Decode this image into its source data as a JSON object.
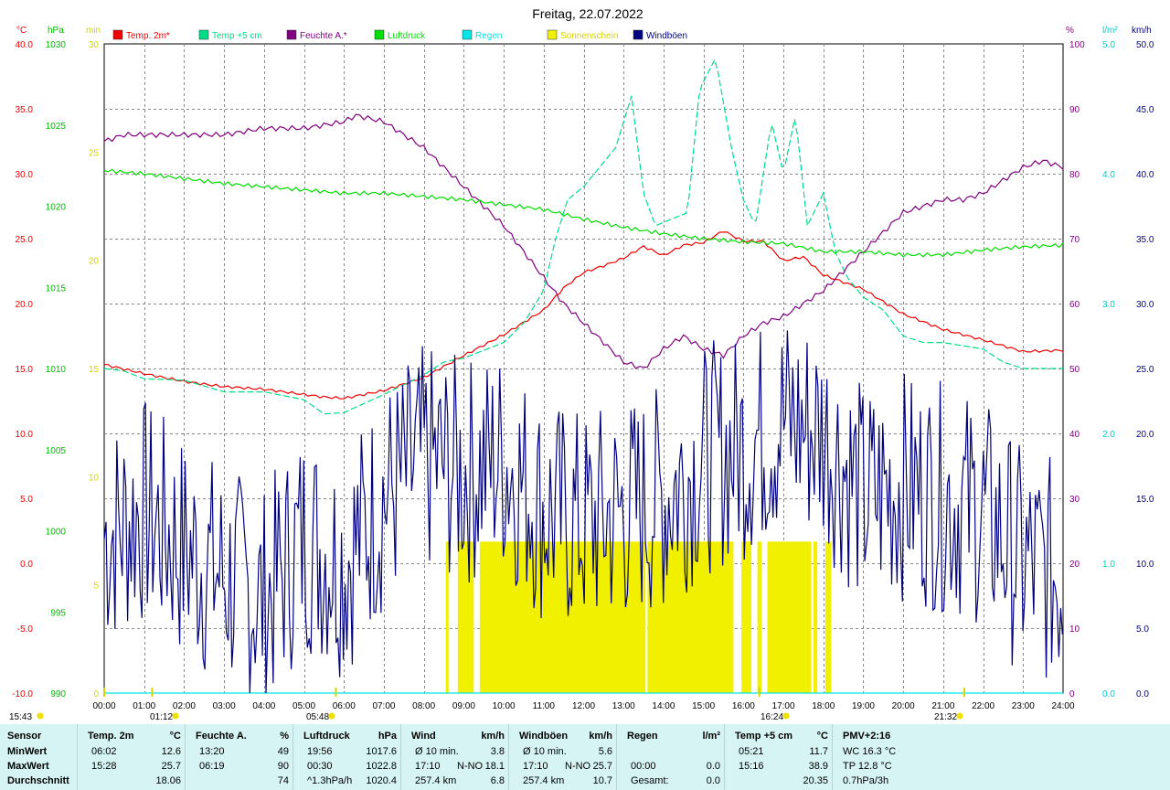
{
  "title": "Freitag, 22.07.2022",
  "axes": {
    "left_units": [
      "°C",
      "hPa",
      "min"
    ],
    "right_units": [
      "%",
      "l/m²",
      "km/h"
    ],
    "temp_ticks": [
      "40.0",
      "35.0",
      "30.0",
      "25.0",
      "20.0",
      "15.0",
      "10.0",
      "5.0",
      "0.0",
      "-5.0",
      "-10.0"
    ],
    "pressure_ticks": [
      "1030",
      "1025",
      "1020",
      "1015",
      "1010",
      "1005",
      "1000",
      "995",
      "990"
    ],
    "sun_ticks": [
      "30",
      "25",
      "20",
      "15",
      "10",
      "5",
      "0"
    ],
    "humidity_ticks": [
      "100",
      "90",
      "80",
      "70",
      "60",
      "50",
      "40",
      "30",
      "20",
      "10",
      "0"
    ],
    "rain_ticks": [
      "5.0",
      "4.0",
      "3.0",
      "2.0",
      "1.0",
      "0.0"
    ],
    "wind_ticks": [
      "50.0",
      "45.0",
      "40.0",
      "35.0",
      "30.0",
      "25.0",
      "20.0",
      "15.0",
      "10.0",
      "5.0",
      "0.0"
    ],
    "time_ticks": [
      "00:00",
      "01:00",
      "02:00",
      "03:00",
      "04:00",
      "05:00",
      "06:00",
      "07:00",
      "08:00",
      "09:00",
      "10:00",
      "11:00",
      "12:00",
      "13:00",
      "14:00",
      "15:00",
      "16:00",
      "17:00",
      "18:00",
      "19:00",
      "20:00",
      "21:00",
      "22:00",
      "23:00",
      "24:00"
    ]
  },
  "markers": {
    "moonset_prev": "15:43",
    "moonset": "01:12",
    "sunrise": "05:48",
    "moonrise": "16:24",
    "sunset": "21:32"
  },
  "legend": [
    {
      "label": "Temp. 2m*",
      "color": "#ee0000"
    },
    {
      "label": "Temp +5 cm",
      "color": "#00dd88"
    },
    {
      "label": "Feuchte A.*",
      "color": "#800080"
    },
    {
      "label": "Luftdruck",
      "color": "#00dd00"
    },
    {
      "label": "Regen",
      "color": "#00e5e5"
    },
    {
      "label": "Sonnenschein",
      "color": "#f0f000"
    },
    {
      "label": "Windböen",
      "color": "#000080"
    }
  ],
  "chart_data": {
    "type": "line",
    "title": "Freitag, 22.07.2022",
    "x_unit": "hour",
    "xlim": [
      0,
      24
    ],
    "series": [
      {
        "name": "Temp. 2m*",
        "unit": "°C",
        "ylim": [
          -10,
          40
        ],
        "color": "#ee0000",
        "x": [
          0,
          1,
          2,
          3,
          4,
          5,
          5.5,
          6,
          6.5,
          7,
          8,
          9,
          10,
          11,
          11.5,
          12,
          12.5,
          13,
          13.5,
          14,
          14.5,
          15,
          15.5,
          16,
          16.5,
          17,
          17.5,
          18,
          19,
          20,
          21,
          22,
          23,
          24
        ],
        "y": [
          15.3,
          14.6,
          14.0,
          13.6,
          13.4,
          13.0,
          12.8,
          12.7,
          13.0,
          13.3,
          14.3,
          16.0,
          17.6,
          19.5,
          21.2,
          22.4,
          22.9,
          23.5,
          24.4,
          23.7,
          24.5,
          24.7,
          25.6,
          24.8,
          24.8,
          23.3,
          23.6,
          22.2,
          21.1,
          19.2,
          18.0,
          17.2,
          16.3,
          16.4
        ]
      },
      {
        "name": "Temp +5 cm",
        "unit": "°C",
        "ylim": [
          -10,
          40
        ],
        "color": "#00dd88",
        "x": [
          0,
          0.5,
          1,
          2,
          3,
          4,
          5,
          5.5,
          6,
          7,
          8,
          8.5,
          9,
          10,
          10.5,
          11,
          11.3,
          11.6,
          12,
          12.4,
          12.8,
          13.2,
          13.5,
          13.8,
          14.2,
          14.6,
          14.9,
          15.3,
          15.7,
          16,
          16.3,
          16.7,
          17,
          17.3,
          17.6,
          18,
          18.3,
          18.6,
          19,
          19.5,
          20,
          20.5,
          21,
          22,
          22.5,
          23,
          24
        ],
        "y": [
          15.0,
          14.8,
          14.2,
          14.1,
          13.2,
          13.2,
          12.6,
          11.5,
          11.6,
          13.0,
          14.5,
          15.5,
          15.8,
          17.0,
          18.5,
          21.0,
          25.0,
          28.0,
          29.0,
          30.5,
          32.0,
          36.0,
          28.5,
          26.0,
          26.5,
          27.0,
          36.5,
          38.9,
          32.0,
          28.0,
          26.0,
          34.0,
          30.0,
          34.5,
          26.0,
          28.5,
          24.0,
          22.0,
          20.5,
          19.5,
          17.5,
          17.0,
          17.0,
          16.5,
          15.5,
          15.0,
          15.0
        ]
      },
      {
        "name": "Feuchte A.*",
        "unit": "%",
        "ylim": [
          0,
          100
        ],
        "color": "#800080",
        "x": [
          0,
          0.5,
          1,
          2,
          3,
          4,
          5,
          6,
          6.3,
          7,
          8,
          9,
          10,
          10.5,
          11,
          11.5,
          12,
          12.5,
          13,
          13.5,
          14,
          14.5,
          15,
          15.5,
          16,
          16.5,
          17,
          17.5,
          18,
          18.5,
          19,
          19.5,
          20,
          20.5,
          21,
          21.5,
          22,
          22.5,
          23,
          23.5,
          24
        ],
        "y": [
          85,
          86,
          86,
          86,
          86,
          87,
          87,
          88,
          89,
          88,
          84,
          78,
          72,
          68,
          64,
          60,
          57,
          54,
          51,
          50,
          53,
          55,
          53,
          52,
          55,
          57,
          58,
          60,
          62,
          65,
          68,
          71,
          74,
          75,
          76,
          76,
          77,
          79,
          81,
          82,
          81
        ]
      },
      {
        "name": "Luftdruck",
        "unit": "hPa",
        "ylim": [
          990,
          1030
        ],
        "color": "#00dd00",
        "x": [
          0,
          1,
          2,
          3,
          4,
          5,
          6,
          7,
          8,
          9,
          10,
          11,
          12,
          13,
          14,
          15,
          16,
          17,
          18,
          19,
          20,
          21,
          22,
          23,
          24
        ],
        "y": [
          1022.2,
          1022.0,
          1021.7,
          1021.4,
          1021.2,
          1021.0,
          1020.8,
          1020.8,
          1020.6,
          1020.4,
          1020.1,
          1019.8,
          1019.2,
          1018.7,
          1018.3,
          1018.0,
          1017.8,
          1017.7,
          1017.2,
          1017.2,
          1017.0,
          1017.0,
          1017.3,
          1017.5,
          1017.6
        ]
      },
      {
        "name": "Regen",
        "unit": "l/m²",
        "ylim": [
          0,
          5
        ],
        "color": "#00e5e5",
        "x": [
          0,
          24
        ],
        "y": [
          0,
          0
        ]
      },
      {
        "name": "Windböen",
        "unit": "km/h",
        "ylim": [
          0,
          50
        ],
        "color": "#000080",
        "x": [
          0,
          1,
          2,
          3,
          4,
          5,
          6,
          7,
          8,
          9,
          10,
          11,
          12,
          13,
          14,
          15,
          16,
          17,
          18,
          19,
          20,
          21,
          22,
          23,
          24
        ],
        "y": [
          12,
          14,
          11,
          9,
          7,
          12,
          10,
          15,
          18,
          17,
          18,
          14,
          13,
          14,
          15,
          18,
          19,
          21,
          20,
          15,
          16,
          15,
          14,
          10,
          9
        ]
      }
    ],
    "sunshine_intervals": [
      [
        8.55,
        8.62
      ],
      [
        8.85,
        9.25
      ],
      [
        9.4,
        13.55
      ],
      [
        13.6,
        15.75
      ],
      [
        15.95,
        16.2
      ],
      [
        16.35,
        16.45
      ],
      [
        16.6,
        17.7
      ],
      [
        17.75,
        17.85
      ],
      [
        18.05,
        18.2
      ]
    ]
  },
  "stats": {
    "headers": [
      {
        "name": "Sensor",
        "unit": ""
      },
      {
        "name": "Temp. 2m",
        "unit": "°C"
      },
      {
        "name": "Feuchte A.",
        "unit": "%"
      },
      {
        "name": "Luftdruck",
        "unit": "hPa"
      },
      {
        "name": "Wind",
        "unit": "km/h"
      },
      {
        "name": "Windböen",
        "unit": "km/h"
      },
      {
        "name": "Regen",
        "unit": "l/m²"
      },
      {
        "name": "Temp +5 cm",
        "unit": "°C"
      },
      {
        "name": "PMV+2:16",
        "unit": ""
      }
    ],
    "rows": [
      "MinWert",
      "MaxWert",
      "Durchschnitt"
    ],
    "temp": [
      [
        "06:02",
        "12.6"
      ],
      [
        "15:28",
        "25.7"
      ],
      [
        "",
        "18.06"
      ]
    ],
    "humidity": [
      [
        "13:20",
        "49"
      ],
      [
        "06:19",
        "90"
      ],
      [
        "",
        "74"
      ]
    ],
    "pressure": [
      [
        "19:56",
        "1017.6"
      ],
      [
        "00:30",
        "1022.8"
      ],
      [
        "^1.3hPa/h",
        "1020.4"
      ]
    ],
    "wind": [
      [
        "Ø 10 min.",
        "",
        "3.8"
      ],
      [
        "17:10",
        "N-NO",
        "18.1"
      ],
      [
        "257.4 km",
        "",
        "6.8"
      ]
    ],
    "gusts": [
      [
        "Ø 10 min.",
        "",
        "5.6"
      ],
      [
        "17:10",
        "N-NO",
        "25.7"
      ],
      [
        "257.4 km",
        "",
        "10.7"
      ]
    ],
    "rain": [
      [
        "",
        ""
      ],
      [
        "00:00",
        "0.0"
      ],
      [
        "Gesamt:",
        "0.0"
      ]
    ],
    "temp5": [
      [
        "05:21",
        "11.7"
      ],
      [
        "15:16",
        "38.9"
      ],
      [
        "",
        "20.35"
      ]
    ],
    "pmv": [
      "WC 16.3 °C",
      "TP 12.8 °C",
      "0.7hPa/3h"
    ]
  }
}
